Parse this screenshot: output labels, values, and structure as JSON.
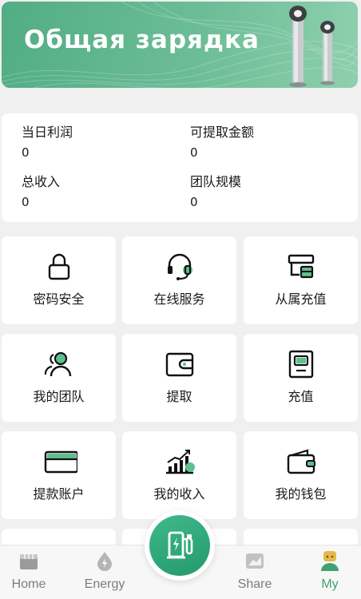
{
  "banner": {
    "title": "Общая зарядка"
  },
  "stats": [
    {
      "label": "当日利润",
      "value": "0"
    },
    {
      "label": "可提取金额",
      "value": "0"
    },
    {
      "label": "总收入",
      "value": "0"
    },
    {
      "label": "团队规模",
      "value": "0"
    }
  ],
  "menu": [
    {
      "label": "密码安全",
      "icon": "lock-icon"
    },
    {
      "label": "在线服务",
      "icon": "headset-icon"
    },
    {
      "label": "从属充值",
      "icon": "subordinate-recharge-icon"
    },
    {
      "label": "我的团队",
      "icon": "team-icon"
    },
    {
      "label": "提取",
      "icon": "wallet-withdraw-icon"
    },
    {
      "label": "充值",
      "icon": "recharge-icon"
    },
    {
      "label": "提款账户",
      "icon": "card-icon"
    },
    {
      "label": "我的收入",
      "icon": "income-chart-icon"
    },
    {
      "label": "我的钱包",
      "icon": "wallet-icon"
    }
  ],
  "tabbar": {
    "items": [
      {
        "label": "Home",
        "icon": "home-icon",
        "active": false
      },
      {
        "label": "Energy",
        "icon": "energy-icon",
        "active": false
      },
      {
        "label": "Share",
        "icon": "share-icon",
        "active": false
      },
      {
        "label": "My",
        "icon": "user-icon",
        "active": true
      }
    ],
    "center_icon": "charging-station-icon"
  },
  "colors": {
    "accent": "#41a271",
    "banner": "#5fb68c",
    "background": "#f0f0f1"
  }
}
